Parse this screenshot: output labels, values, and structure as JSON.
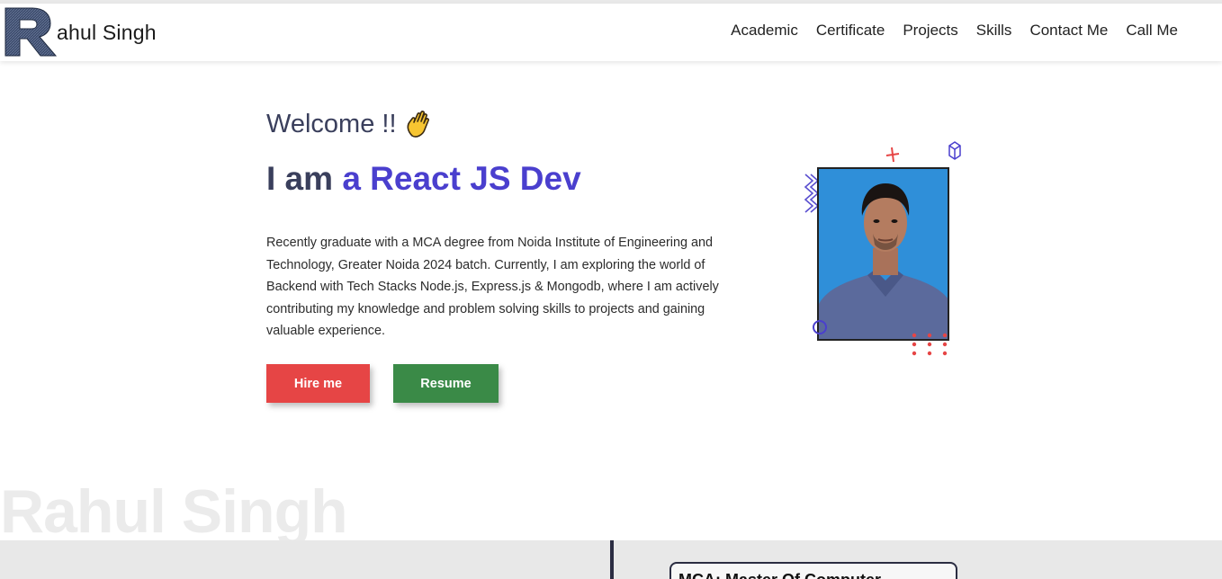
{
  "logo": {
    "mark": "R",
    "text": "ahul Singh"
  },
  "nav": {
    "items": [
      {
        "label": "Academic"
      },
      {
        "label": "Certificate"
      },
      {
        "label": "Projects"
      },
      {
        "label": "Skills"
      },
      {
        "label": "Contact Me"
      },
      {
        "label": "Call Me"
      }
    ]
  },
  "hero": {
    "welcome": "Welcome !!",
    "wave_icon": "waving-hand-icon",
    "headline_prefix": "I am ",
    "headline_accent": "a React JS Dev",
    "bio": "Recently graduate with a MCA degree from Noida Institute of Engineering and Technology, Greater Noida 2024 batch. Currently, I am exploring the world of Backend with Tech Stacks Node.js, Express.js & Mongodb, where I am actively contributing my knowledge and problem solving skills to projects and gaining valuable experience.",
    "hire_label": "Hire me",
    "resume_label": "Resume"
  },
  "background_name": "Rahul Singh",
  "academic": {
    "first_card_title": "MCA: Master Of Computer"
  },
  "colors": {
    "accent": "#4a3fce",
    "hire": "#e64545",
    "resume": "#3a8a47",
    "heading": "#3a3f5c"
  }
}
